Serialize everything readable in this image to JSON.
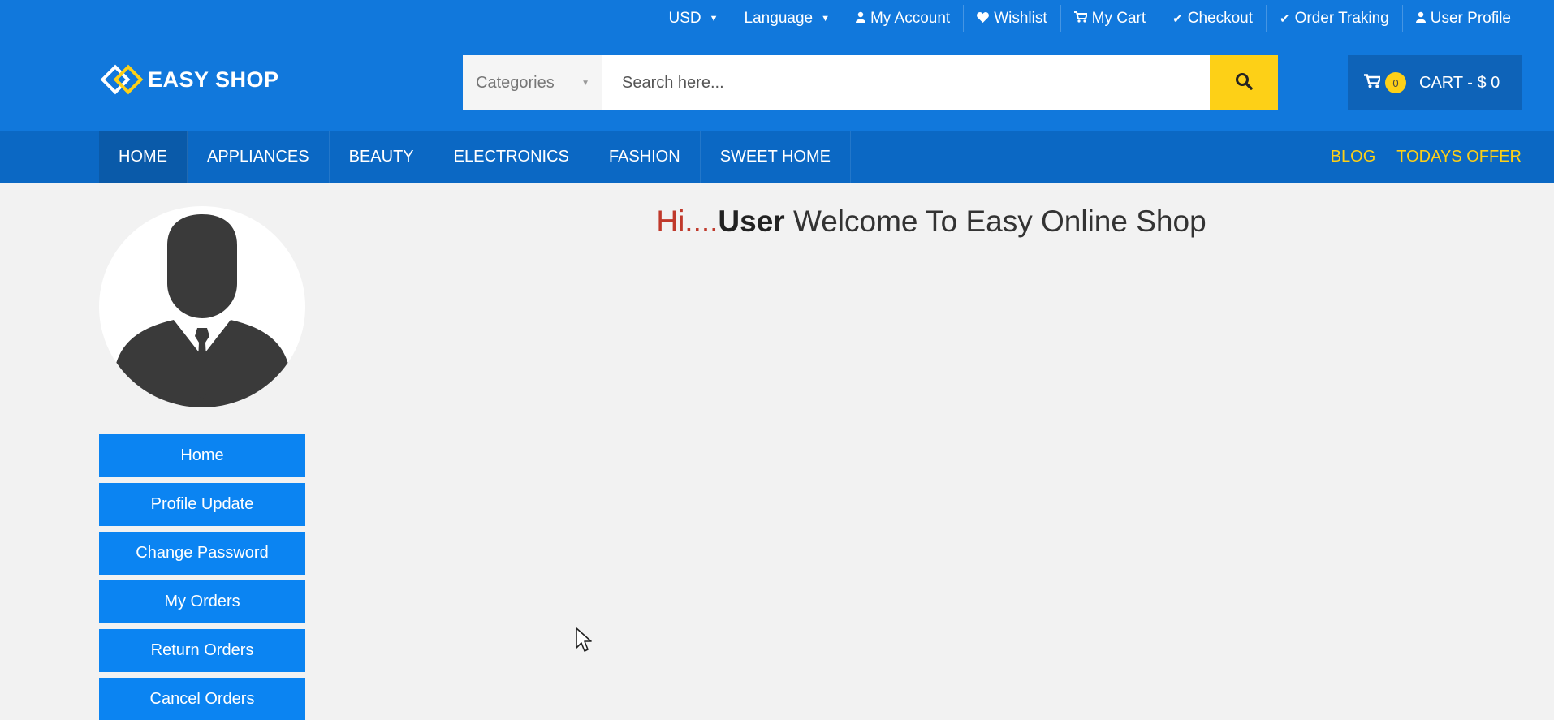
{
  "topbar": {
    "currency": "USD",
    "language": "Language",
    "my_account": "My Account",
    "wishlist": "Wishlist",
    "my_cart": "My Cart",
    "checkout": "Checkout",
    "order_tracking": "Order Traking",
    "user_profile": "User Profile"
  },
  "logo": {
    "text": "EASY SHOP"
  },
  "search": {
    "category_label": "Categories",
    "placeholder": "Search here...",
    "button_icon": "search-icon"
  },
  "cart": {
    "count": "0",
    "label": "CART - $ 0"
  },
  "nav": {
    "items": [
      "HOME",
      "APPLIANCES",
      "BEAUTY",
      "ELECTRONICS",
      "FASHION",
      "SWEET HOME"
    ],
    "active": "HOME",
    "blog": "BLOG",
    "todays_offer": "TODAYS OFFER"
  },
  "welcome": {
    "hi": "Hi....",
    "user": "User",
    "message": " Welcome To Easy Online Shop"
  },
  "sidebar": {
    "buttons": [
      "Home",
      "Profile Update",
      "Change Password",
      "My Orders",
      "Return Orders",
      "Cancel Orders"
    ]
  },
  "colors": {
    "header_bg": "#1178dc",
    "nav_bg": "#0b68c4",
    "accent_yellow": "#fdd017",
    "sidebar_button": "#0b84f2",
    "page_bg": "#f2f2f2",
    "hi_red": "#c0392b"
  }
}
